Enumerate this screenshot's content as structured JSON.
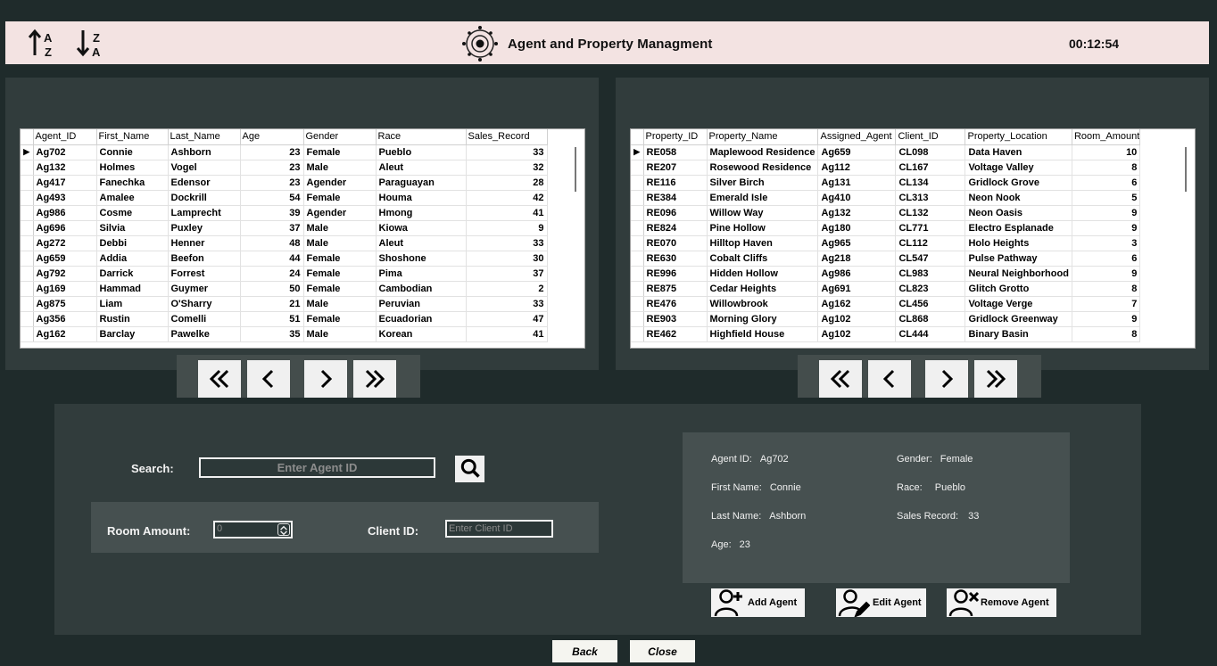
{
  "header": {
    "title": "Agent and Property Managment",
    "clock": "00:12:54"
  },
  "agents": {
    "columns": [
      "Agent_ID",
      "First_Name",
      "Last_Name",
      "Age",
      "Gender",
      "Race",
      "Sales_Record"
    ],
    "rows": [
      [
        "Ag702",
        "Connie",
        "Ashborn",
        "23",
        "Female",
        "Pueblo",
        "33"
      ],
      [
        "Ag132",
        "Holmes",
        "Vogel",
        "23",
        "Male",
        "Aleut",
        "32"
      ],
      [
        "Ag417",
        "Fanechka",
        "Edensor",
        "23",
        "Agender",
        "Paraguayan",
        "28"
      ],
      [
        "Ag493",
        "Amalee",
        "Dockrill",
        "54",
        "Female",
        "Houma",
        "42"
      ],
      [
        "Ag986",
        "Cosme",
        "Lamprecht",
        "39",
        "Agender",
        "Hmong",
        "41"
      ],
      [
        "Ag696",
        "Silvia",
        "Puxley",
        "37",
        "Male",
        "Kiowa",
        "9"
      ],
      [
        "Ag272",
        "Debbi",
        "Henner",
        "48",
        "Male",
        "Aleut",
        "33"
      ],
      [
        "Ag659",
        "Addia",
        "Beefon",
        "44",
        "Female",
        "Shoshone",
        "30"
      ],
      [
        "Ag792",
        "Darrick",
        "Forrest",
        "24",
        "Female",
        "Pima",
        "37"
      ],
      [
        "Ag169",
        "Hammad",
        "Guymer",
        "50",
        "Female",
        "Cambodian",
        "2"
      ],
      [
        "Ag875",
        "Liam",
        "O'Sharry",
        "21",
        "Male",
        "Peruvian",
        "33"
      ],
      [
        "Ag356",
        "Rustin",
        "Comelli",
        "51",
        "Female",
        "Ecuadorian",
        "47"
      ],
      [
        "Ag162",
        "Barclay",
        "Pawelke",
        "35",
        "Male",
        "Korean",
        "41"
      ]
    ]
  },
  "properties": {
    "columns": [
      "Property_ID",
      "Property_Name",
      "Assigned_Agent",
      "Client_ID",
      "Property_Location",
      "Room_Amount"
    ],
    "rows": [
      [
        "RE058",
        "Maplewood Residence",
        "Ag659",
        "CL098",
        "Data Haven",
        "10"
      ],
      [
        "RE207",
        "Rosewood Residence",
        "Ag112",
        "CL167",
        "Voltage Valley",
        "8"
      ],
      [
        "RE116",
        "Silver Birch",
        "Ag131",
        "CL134",
        "Gridlock Grove",
        "6"
      ],
      [
        "RE384",
        "Emerald Isle",
        "Ag410",
        "CL313",
        "Neon Nook",
        "5"
      ],
      [
        "RE096",
        "Willow Way",
        "Ag132",
        "CL132",
        "Neon Oasis",
        "9"
      ],
      [
        "RE824",
        "Pine Hollow",
        "Ag180",
        "CL771",
        "Electro Esplanade",
        "9"
      ],
      [
        "RE070",
        "Hilltop Haven",
        "Ag965",
        "CL112",
        "Holo Heights",
        "3"
      ],
      [
        "RE630",
        "Cobalt Cliffs",
        "Ag218",
        "CL547",
        "Pulse Pathway",
        "6"
      ],
      [
        "RE996",
        "Hidden Hollow",
        "Ag986",
        "CL983",
        "Neural Neighborhood",
        "9"
      ],
      [
        "RE875",
        "Cedar Heights",
        "Ag691",
        "CL823",
        "Glitch Grotto",
        "8"
      ],
      [
        "RE476",
        "Willowbrook",
        "Ag162",
        "CL456",
        "Voltage Verge",
        "7"
      ],
      [
        "RE903",
        "Morning Glory",
        "Ag102",
        "CL868",
        "Gridlock Greenway",
        "9"
      ],
      [
        "RE462",
        "Highfield House",
        "Ag102",
        "CL444",
        "Binary Basin",
        "8"
      ]
    ]
  },
  "form": {
    "search_label": "Search:",
    "search_placeholder": "Enter Agent ID",
    "room_amount_label": "Room Amount:",
    "room_amount_value": "0",
    "client_id_label": "Client ID:",
    "client_id_placeholder": "Enter Client ID"
  },
  "details": {
    "agent_id_label": "Agent ID:",
    "agent_id": "Ag702",
    "first_name_label": "First Name:",
    "first_name": "Connie",
    "last_name_label": "Last Name:",
    "last_name": "Ashborn",
    "age_label": "Age:",
    "age": "23",
    "gender_label": "Gender:",
    "gender": "Female",
    "race_label": "Race:",
    "race": "Pueblo",
    "sales_record_label": "Sales Record:",
    "sales_record": "33"
  },
  "actions": {
    "add_agent": "Add Agent",
    "edit_agent": "Edit Agent",
    "remove_agent": "Remove Agent"
  },
  "footer": {
    "back": "Back",
    "close": "Close"
  },
  "icons": {
    "sort_asc": "sort-ascending-icon",
    "sort_desc": "sort-descending-icon",
    "logo": "atom-logo-icon",
    "search": "magnifier-icon",
    "first": "double-chevron-left-icon",
    "prev": "chevron-left-icon",
    "next": "chevron-right-icon",
    "last": "double-chevron-right-icon"
  },
  "colors": {
    "background": "#1f2b2b",
    "panel": "#313c3c",
    "titlebar": "#f3e3e2",
    "button": "#f0f0f0"
  }
}
